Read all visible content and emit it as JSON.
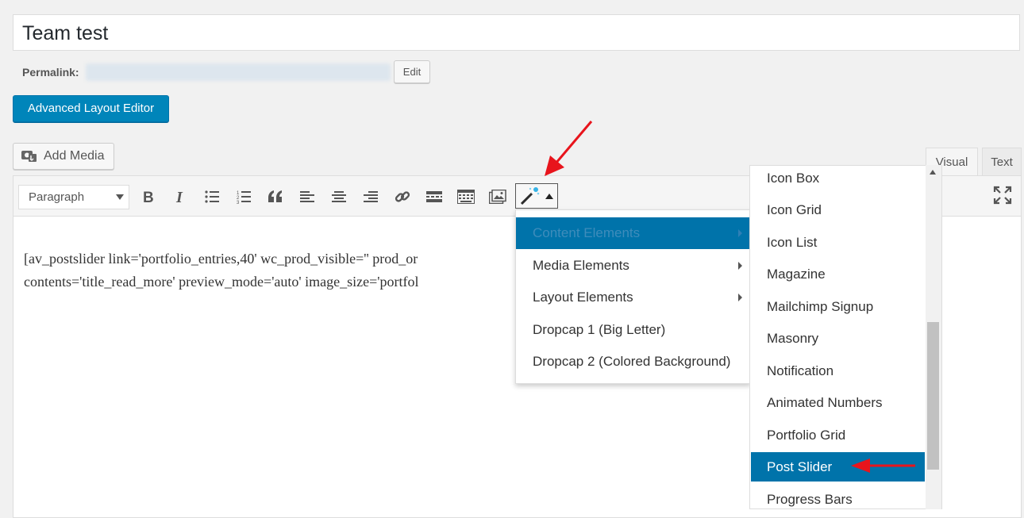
{
  "post": {
    "title": "Team test"
  },
  "permalink": {
    "label": "Permalink:",
    "edit_label": "Edit"
  },
  "advanced_layout_editor_label": "Advanced Layout Editor",
  "add_media_label": "Add Media",
  "tabs": {
    "visual": "Visual",
    "text": "Text"
  },
  "toolbar": {
    "format_select": "Paragraph",
    "icons": [
      "bold-icon",
      "italic-icon",
      "bullet-list-icon",
      "numbered-list-icon",
      "blockquote-icon",
      "align-left-icon",
      "align-center-icon",
      "align-right-icon",
      "link-icon",
      "read-more-icon",
      "toolbar-toggle-icon",
      "media-gallery-icon",
      "magic-wand-icon",
      "fullscreen-icon"
    ]
  },
  "editor": {
    "line1": "[av_postslider link='portfolio_entries,40' wc_prod_visible='' prod_or",
    "line2": "contents='title_read_more' preview_mode='auto' image_size='portfol"
  },
  "shortcode_menu": {
    "items": [
      {
        "label": "Content Elements",
        "submenu": true,
        "active": true
      },
      {
        "label": "Media Elements",
        "submenu": true
      },
      {
        "label": "Layout Elements",
        "submenu": true
      },
      {
        "label": "Dropcap 1 (Big Letter)",
        "submenu": false
      },
      {
        "label": "Dropcap 2 (Colored Background)",
        "submenu": false
      }
    ]
  },
  "content_elements_submenu": {
    "items": [
      "Icon Box",
      "Icon Grid",
      "Icon List",
      "Magazine",
      "Mailchimp Signup",
      "Masonry",
      "Notification",
      "Animated Numbers",
      "Portfolio Grid",
      "Post Slider",
      "Progress Bars"
    ],
    "selected": "Post Slider"
  },
  "colors": {
    "accent": "#0073aa",
    "button_primary": "#0085ba",
    "annotation_arrow": "#e8141c"
  }
}
